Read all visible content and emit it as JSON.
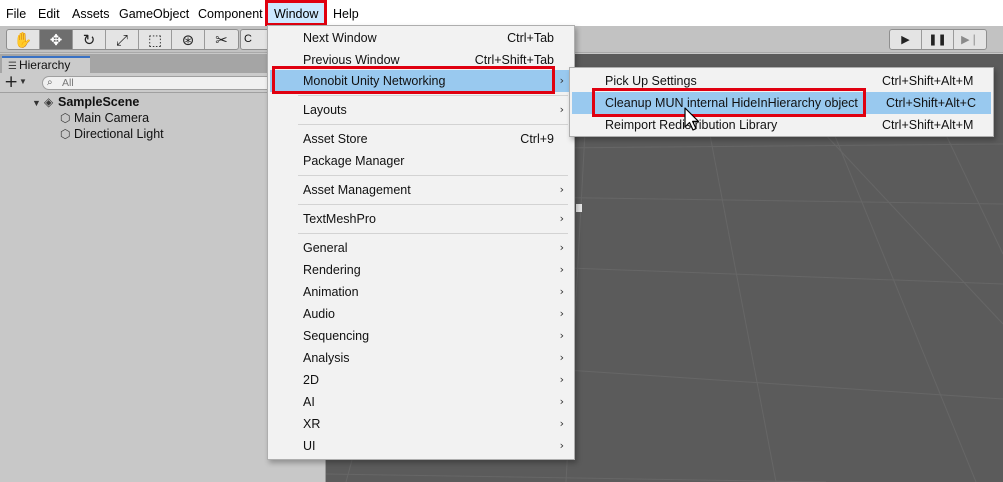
{
  "menubar": {
    "items": [
      {
        "label": "File"
      },
      {
        "label": "Edit"
      },
      {
        "label": "Assets"
      },
      {
        "label": "GameObject"
      },
      {
        "label": "Component"
      },
      {
        "label": "Window"
      },
      {
        "label": "Help"
      }
    ],
    "active_item": "Window"
  },
  "toolbar": {
    "tools": [
      "hand-tool-icon",
      "move-tool-icon",
      "rotate-tool-icon",
      "scale-tool-icon",
      "rect-tool-icon",
      "transform-tool-icon",
      "custom-tool-icon"
    ],
    "pivot_label": "C",
    "play_controls": [
      "play-icon",
      "pause-icon",
      "step-icon"
    ]
  },
  "hierarchy": {
    "tab_label": "Hierarchy",
    "add_label": "+",
    "search_placeholder": "All",
    "scene_name": "SampleScene",
    "objects": [
      "Main Camera",
      "Directional Light"
    ]
  },
  "window_menu": {
    "items": [
      {
        "label": "Next Window",
        "shortcut": "Ctrl+Tab"
      },
      {
        "label": "Previous Window",
        "shortcut": "Ctrl+Shift+Tab"
      },
      {
        "label": "Monobit Unity Networking",
        "submenu": true,
        "highlighted": true
      },
      {
        "label": "Layouts",
        "submenu": true
      },
      {
        "label": "Asset Store",
        "shortcut": "Ctrl+9"
      },
      {
        "label": "Package Manager"
      },
      {
        "label": "Asset Management",
        "submenu": true
      },
      {
        "label": "TextMeshPro",
        "submenu": true
      },
      {
        "label": "General",
        "submenu": true
      },
      {
        "label": "Rendering",
        "submenu": true
      },
      {
        "label": "Animation",
        "submenu": true
      },
      {
        "label": "Audio",
        "submenu": true
      },
      {
        "label": "Sequencing",
        "submenu": true
      },
      {
        "label": "Analysis",
        "submenu": true
      },
      {
        "label": "2D",
        "submenu": true
      },
      {
        "label": "AI",
        "submenu": true
      },
      {
        "label": "XR",
        "submenu": true
      },
      {
        "label": "UI",
        "submenu": true
      }
    ],
    "submenu_arrow": "›"
  },
  "networking_submenu": {
    "items": [
      {
        "label": "Pick Up Settings",
        "shortcut": "Ctrl+Shift+Alt+M"
      },
      {
        "label": "Cleanup MUN internal HideInHierarchy object",
        "shortcut": "Ctrl+Shift+Alt+C",
        "highlighted": true
      },
      {
        "label": "Reimport Redistribution Library",
        "shortcut": "Ctrl+Shift+Alt+M"
      }
    ]
  },
  "colors": {
    "menu_highlight": "#99c9ef",
    "annotation_red": "#e00010",
    "scene_background": "#5b5b5b",
    "panel_background": "#c8c8c8"
  }
}
